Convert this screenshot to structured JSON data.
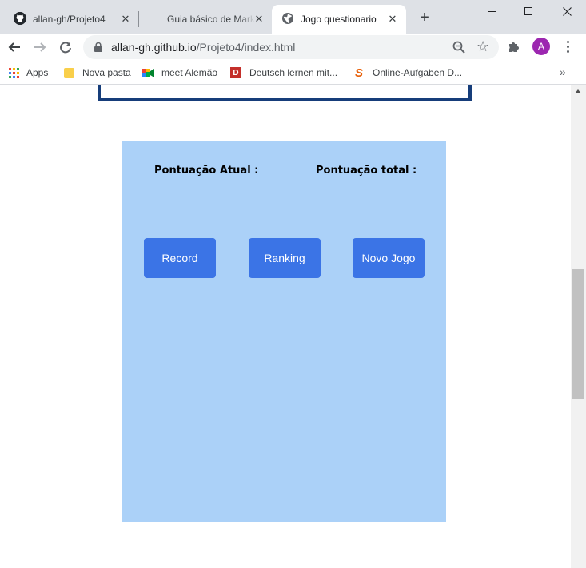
{
  "browser": {
    "tabs": [
      {
        "title": "allan-gh/Projeto4",
        "icon": "github-icon",
        "close": "✕"
      },
      {
        "title": "Guia básico de Markdown",
        "icon": "none",
        "close": "✕"
      },
      {
        "title": "Jogo questionario",
        "icon": "globe-icon",
        "close": "✕",
        "active": true
      }
    ],
    "new_tab": "+",
    "url_host": "allan-gh.github.io",
    "url_path": "/Projeto4/index.html",
    "avatar_letter": "A",
    "bookmarks": [
      {
        "label": "Apps",
        "icon": "apps-grid-icon"
      },
      {
        "label": "Nova pasta",
        "icon": "folder-icon"
      },
      {
        "label": "meet Alemão",
        "icon": "meet-icon"
      },
      {
        "label": "Deutsch lernen mit...",
        "icon": "d-icon"
      },
      {
        "label": "Online-Aufgaben D...",
        "icon": "s-icon"
      }
    ],
    "more_bookmarks": "»",
    "colors": {
      "tabstrip": "#dee1e6",
      "avatar": "#9c27b0"
    }
  },
  "page": {
    "score_current_label": "Pontuação Atual :",
    "score_total_label": "Pontuação total :",
    "buttons": {
      "record": "Record",
      "ranking": "Ranking",
      "new_game": "Novo Jogo"
    },
    "colors": {
      "panel": "#abd1f8",
      "button": "#3b74e6",
      "quiz_border": "#163d7a"
    }
  }
}
